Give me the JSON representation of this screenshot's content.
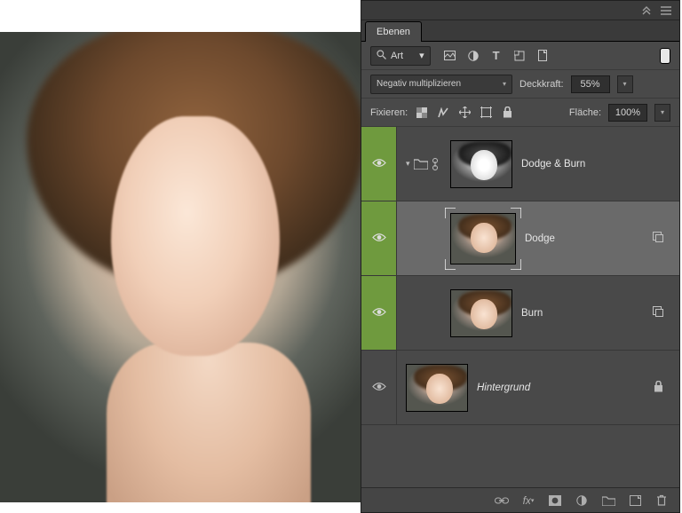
{
  "panel": {
    "title": "Ebenen",
    "filter_label": "Art",
    "blend_mode": "Negativ multiplizieren",
    "opacity_label": "Deckkraft:",
    "opacity_value": "55%",
    "lock_label": "Fixieren:",
    "fill_label": "Fläche:",
    "fill_value": "100%"
  },
  "layers": [
    {
      "name": "Dodge & Burn",
      "type": "group",
      "visible": true,
      "green": true,
      "thumb": "bw"
    },
    {
      "name": "Dodge",
      "type": "smart",
      "visible": true,
      "green": true,
      "selected": true,
      "thumb": "color"
    },
    {
      "name": "Burn",
      "type": "smart",
      "visible": true,
      "green": true,
      "thumb": "color"
    },
    {
      "name": "Hintergrund",
      "type": "background",
      "visible": true,
      "green": false,
      "locked": true,
      "italic": true,
      "thumb": "color"
    }
  ]
}
